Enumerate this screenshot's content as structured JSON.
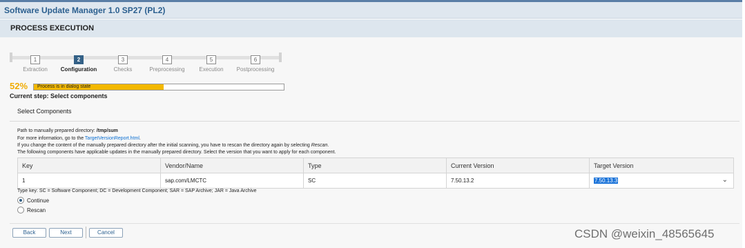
{
  "app_title": "Software Update Manager 1.0 SP27 (PL2)",
  "section_title": "PROCESS EXECUTION",
  "steps": [
    {
      "num": "1",
      "label": "Extraction"
    },
    {
      "num": "2",
      "label": "Configuration"
    },
    {
      "num": "3",
      "label": "Checks"
    },
    {
      "num": "4",
      "label": "Preprocessing"
    },
    {
      "num": "5",
      "label": "Execution"
    },
    {
      "num": "6",
      "label": "Postprocessing"
    }
  ],
  "active_step": 2,
  "progress": {
    "percent_text": "52%",
    "value": 0.52,
    "status": "Process is in dialog state"
  },
  "current_step": "Current step: Select components",
  "panel_title": "Select Components",
  "info": {
    "path_prefix": "Path to manually prepared directory: ",
    "path_value": "/tmp/sum",
    "more_info_prefix": "For more information, go to the ",
    "more_info_link": "TargetVersionReport.html",
    "more_info_suffix": ".",
    "rescan_note_prefix": "If you change the content of the manually prepared directory after the initial scanning, you have to rescan the directory again by selecting ",
    "rescan_note_em": "Rescan",
    "rescan_note_suffix": ".",
    "components_note": "The following components have applicable updates in the manually prepared directory. Select the version that you want to apply for each component."
  },
  "table": {
    "headers": [
      "Key",
      "Vendor/Name",
      "Type",
      "Current Version",
      "Target Version"
    ],
    "rows": [
      {
        "key": "1",
        "vendor": "sap.com/LMCTC",
        "type": "SC",
        "current": "7.50.13.2",
        "target": "7.50.13.3"
      }
    ]
  },
  "type_key": "Type key: SC = Software Component; DC = Development Component; SAR = SAP Archive; JAR = Java Archive",
  "options": {
    "continue": "Continue",
    "rescan": "Rescan",
    "selected": "continue"
  },
  "buttons": {
    "back": "Back",
    "next": "Next",
    "cancel": "Cancel"
  },
  "watermark": "CSDN @weixin_48565645",
  "colors": {
    "accent": "#346187",
    "progress": "#f3b800",
    "percent": "#f0ab00",
    "link": "#0a6ed1"
  }
}
